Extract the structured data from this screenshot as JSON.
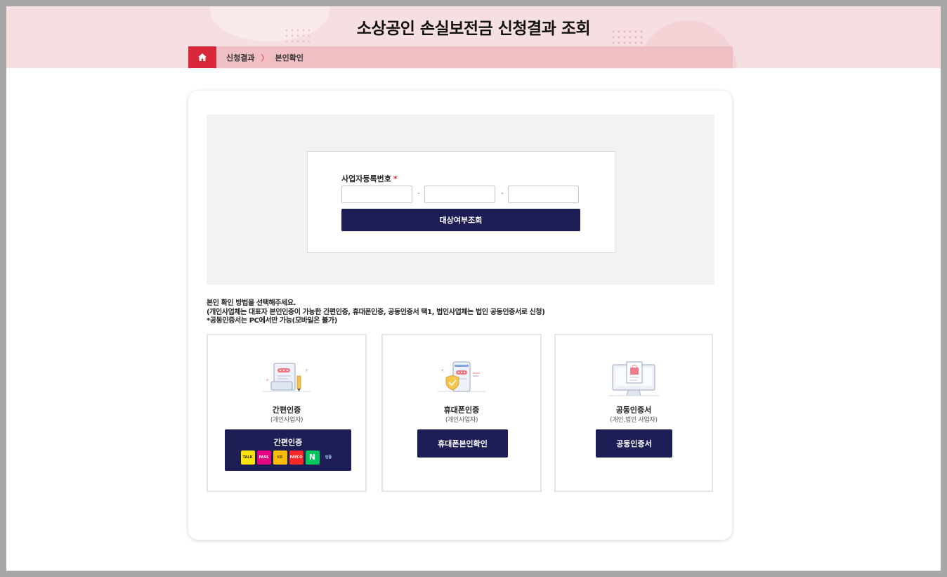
{
  "header": {
    "title": "소상공인 손실보전금 신청결과 조회",
    "breadcrumb": [
      "신청결과",
      "본인확인"
    ],
    "breadcrumb_separator": "〉"
  },
  "colors": {
    "accent_red": "#d8283a",
    "navy": "#1c1e55",
    "hero_pink": "#f6dfe1",
    "breadcrumb_pink": "#efbfc3",
    "panel_grey": "#f2f2f3"
  },
  "lookup_form": {
    "label": "사업자등록번호",
    "required_mark": "*",
    "fields": [
      {
        "value": "",
        "placeholder": ""
      },
      {
        "value": "",
        "placeholder": ""
      },
      {
        "value": "",
        "placeholder": ""
      }
    ],
    "separator": "-",
    "submit_label": "대상여부조회"
  },
  "instructions": {
    "line1": "본인 확인 방법을 선택해주세요.",
    "line2": "(개인사업체는 대표자 본인인증이 가능한 간편인증, 휴대폰인증, 공동인증서 택1, 법인사업체는 법인 공동인증서로 신청)",
    "line3": "*공동인증서는 PC에서만 가능(모바일은 불가)"
  },
  "methods": [
    {
      "title": "간편인증",
      "subtitle": "(개인사업자)",
      "button_label": "간편인증",
      "icon": "document-pen-icon",
      "providers": [
        "TALK",
        "PASS",
        "KB",
        "PAYCO",
        "N",
        "인증"
      ]
    },
    {
      "title": "휴대폰인증",
      "subtitle": "(개인사업자)",
      "button_label": "휴대폰본인확인",
      "icon": "phone-shield-icon"
    },
    {
      "title": "공동인증서",
      "subtitle": "(개인,법인 사업자)",
      "button_label": "공동인증서",
      "icon": "monitor-certificate-icon"
    }
  ]
}
